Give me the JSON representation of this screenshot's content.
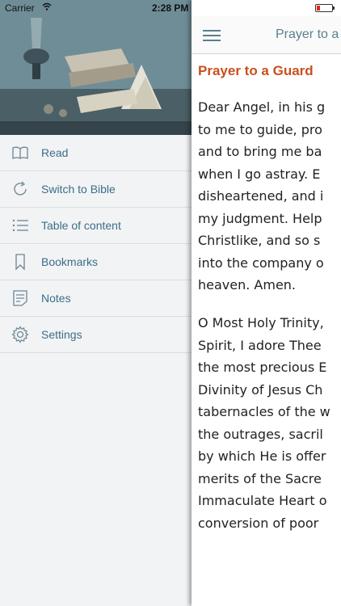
{
  "status": {
    "carrier": "Carrier",
    "time": "2:28 PM"
  },
  "menu": {
    "items": [
      {
        "label": "Read",
        "icon": "book-icon"
      },
      {
        "label": "Switch to Bible",
        "icon": "refresh-icon"
      },
      {
        "label": "Table of content",
        "icon": "list-icon"
      },
      {
        "label": "Bookmarks",
        "icon": "bookmark-icon"
      },
      {
        "label": "Notes",
        "icon": "notes-icon"
      },
      {
        "label": "Settings",
        "icon": "gear-icon"
      }
    ]
  },
  "nav": {
    "title": "Prayer to a"
  },
  "article": {
    "title": "Prayer to a Guard",
    "paragraph1": [
      "Dear Angel, in his g",
      "to me to guide, pro",
      "and to bring me ba",
      "when I go astray. E",
      "disheartened, and i",
      "my judgment. Help",
      "Christlike, and so s",
      "into the company o",
      "heaven. Amen."
    ],
    "paragraph2": [
      "O Most Holy Trinity,",
      "Spirit, I adore Thee",
      "the most precious E",
      "Divinity of Jesus Ch",
      "tabernacles of the w",
      "the outrages, sacril",
      "by which He is offer",
      "merits of the Sacre",
      "Immaculate Heart o",
      "conversion of poor"
    ]
  },
  "colors": {
    "accent": "#3a6f86",
    "title": "#c8501e"
  }
}
